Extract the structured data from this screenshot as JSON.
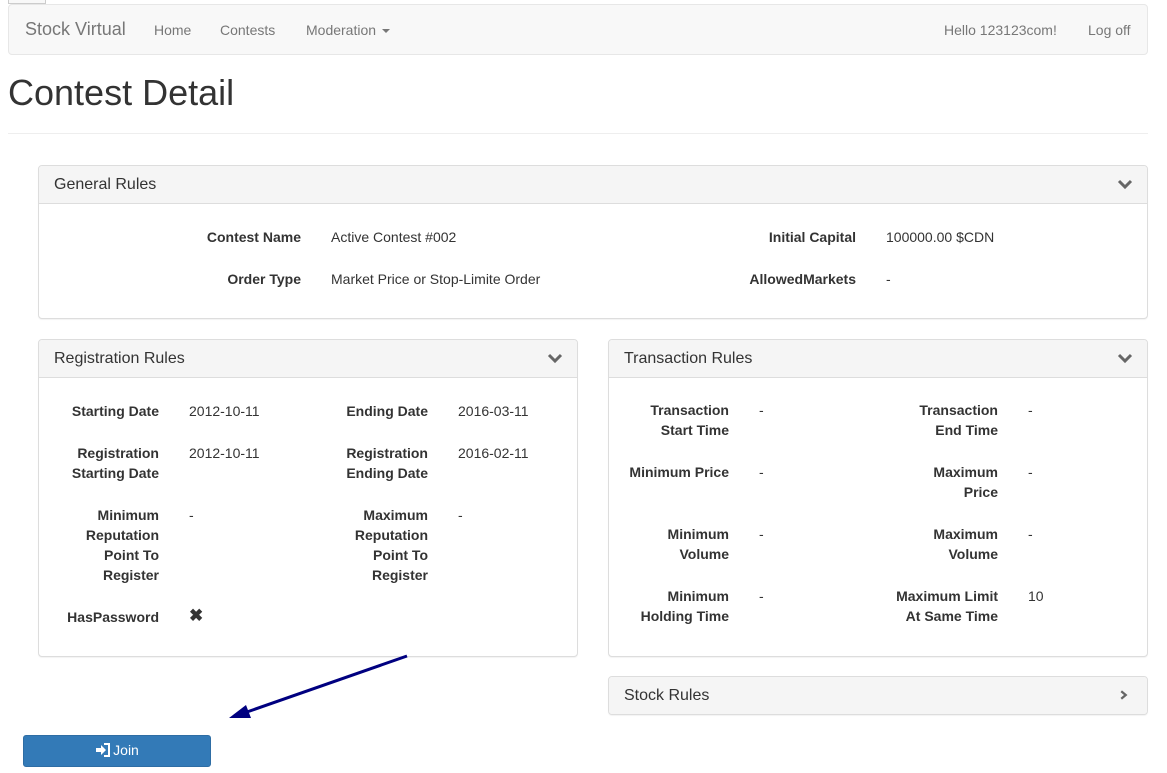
{
  "navbar": {
    "brand": "Stock Virtual",
    "links": [
      "Home",
      "Contests",
      "Moderation"
    ],
    "greeting": "Hello 123123com!",
    "logoff": "Log off"
  },
  "page": {
    "title": "Contest Detail"
  },
  "general_rules": {
    "title": "General Rules",
    "contest_name_label": "Contest Name",
    "contest_name": "Active Contest #002",
    "order_type_label": "Order Type",
    "order_type": "Market Price or Stop-Limite Order",
    "initial_capital_label": "Initial Capital",
    "initial_capital": "100000.00 $CDN",
    "allowed_markets_label": "AllowedMarkets",
    "allowed_markets": "-"
  },
  "registration_rules": {
    "title": "Registration Rules",
    "starting_date_label": "Starting Date",
    "starting_date": "2012-10-11",
    "ending_date_label": "Ending Date",
    "ending_date": "2016-03-11",
    "reg_start_label": [
      "Registration",
      "Starting Date"
    ],
    "reg_start": "2012-10-11",
    "reg_end_label": [
      "Registration",
      "Ending Date"
    ],
    "reg_end": "2016-02-11",
    "min_rep_label": [
      "Minimum",
      "Reputation",
      "Point To",
      "Register"
    ],
    "min_rep": "-",
    "max_rep_label": [
      "Maximum",
      "Reputation",
      "Point To",
      "Register"
    ],
    "max_rep": "-",
    "has_password_label": "HasPassword",
    "has_password": "✖"
  },
  "transaction_rules": {
    "title": "Transaction Rules",
    "start_time_label": [
      "Transaction",
      "Start Time"
    ],
    "start_time": "-",
    "end_time_label": [
      "Transaction",
      "End Time"
    ],
    "end_time": "-",
    "min_price_label": "Minimum Price",
    "min_price": "-",
    "max_price_label": [
      "Maximum",
      "Price"
    ],
    "max_price": "-",
    "min_volume_label": [
      "Minimum",
      "Volume"
    ],
    "min_volume": "-",
    "max_volume_label": [
      "Maximum",
      "Volume"
    ],
    "max_volume": "-",
    "min_holding_label": [
      "Minimum",
      "Holding Time"
    ],
    "min_holding": "-",
    "max_limit_label": [
      "Maximum Limit",
      "At Same Time"
    ],
    "max_limit": "10"
  },
  "stock_rules": {
    "title": "Stock Rules"
  },
  "join_button": {
    "label": "Join",
    "icon": "sign-in-icon"
  },
  "colors": {
    "primary": "#337ab7",
    "annotation_arrow": "#000080"
  }
}
